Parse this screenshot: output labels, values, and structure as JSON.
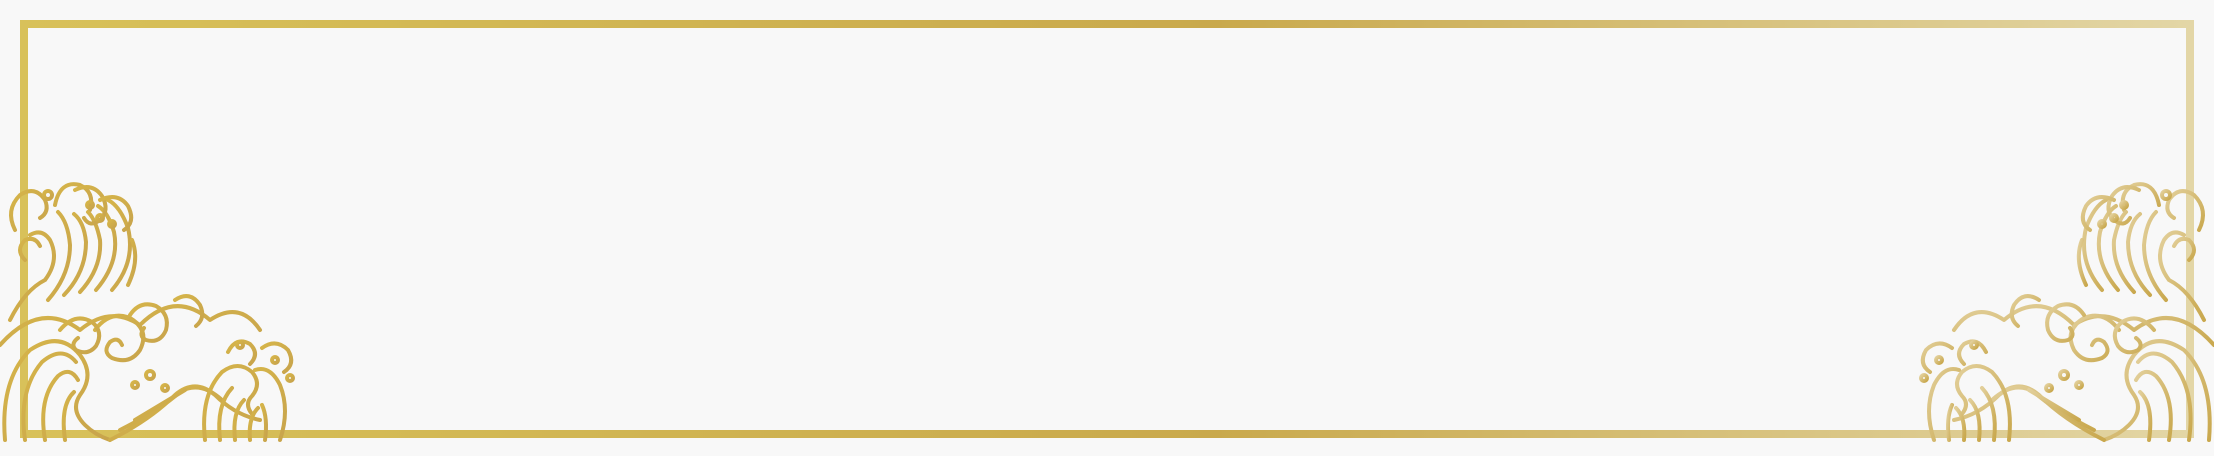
{
  "banner": {
    "background_color": "#f8f8f8",
    "frame_colors": [
      "#d8c15a",
      "#c9a94c",
      "#e3d6a6"
    ],
    "ornament_colors": [
      "#d6b54a",
      "#c8a44c",
      "#e2cf9a"
    ],
    "ornament_motif": "wave-cloud-icon"
  }
}
